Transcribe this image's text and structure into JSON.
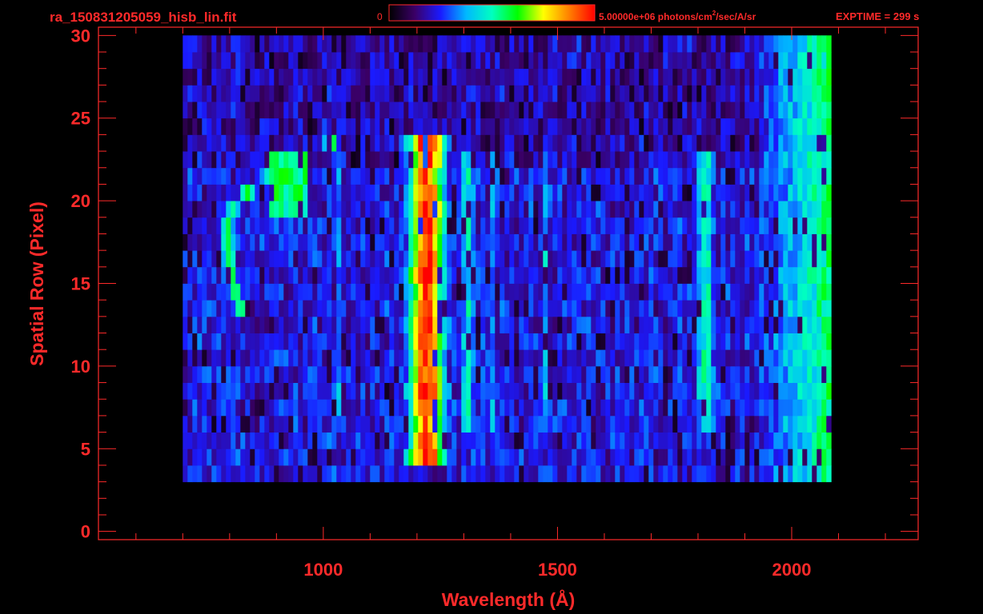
{
  "header": {
    "filename": "ra_150831205059_hisb_lin.fit",
    "colorbar_min_label": "0",
    "colorbar_max_label": "5.00000e+06 photons/cm",
    "colorbar_units_sup": "2",
    "colorbar_units_tail": "/sec/A/sr",
    "exptime_label": "EXPTIME = 299 s"
  },
  "colors": {
    "accent": "#ff2a2a",
    "background": "#000000",
    "colormap": [
      "#000000",
      "#3a0066",
      "#1a1aff",
      "#00b8ff",
      "#00ffc0",
      "#00ff00",
      "#ffff00",
      "#ff8000",
      "#ff0000"
    ]
  },
  "chart_data": {
    "type": "heatmap",
    "title": "",
    "xlabel": "Wavelength (Å)",
    "ylabel": "Spatial Row (Pixel)",
    "xlim": [
      520,
      2270
    ],
    "ylim": [
      -0.5,
      30.5
    ],
    "x_ticks": [
      1000,
      1500,
      2000
    ],
    "y_ticks": [
      0,
      5,
      10,
      15,
      20,
      25,
      30
    ],
    "data_extent": {
      "x": [
        700,
        2080
      ],
      "y": [
        3,
        30
      ]
    },
    "colorbar_range": [
      0,
      5000000
    ],
    "colorbar_unit": "photons/cm^2/sec/A/sr",
    "features": [
      {
        "name": "Lyman-alpha band",
        "x_center": 1216,
        "x_width": 50,
        "y_range": [
          4.5,
          24
        ],
        "peak_level": 0.95
      },
      {
        "name": "arc feature",
        "x_range": [
          780,
          940
        ],
        "y_range": [
          13,
          23.5
        ],
        "peak_level": 0.6
      },
      {
        "name": "emission band",
        "x_center": 1304,
        "x_width": 24,
        "y_range": [
          6,
          23
        ],
        "peak_level": 0.45
      },
      {
        "name": "emission band",
        "x_center": 1356,
        "x_width": 14,
        "y_range": [
          6,
          23
        ],
        "peak_level": 0.35
      },
      {
        "name": "emission band",
        "x_center": 1468,
        "x_width": 14,
        "y_range": [
          6,
          23
        ],
        "peak_level": 0.4
      },
      {
        "name": "emission band",
        "x_center": 1030,
        "x_width": 14,
        "y_range": [
          7,
          23
        ],
        "peak_level": 0.35
      },
      {
        "name": "emission band",
        "x_center": 1810,
        "x_width": 28,
        "y_range": [
          6,
          23
        ],
        "peak_level": 0.5
      },
      {
        "name": "long-wavelength edge",
        "x_range": [
          1930,
          2075
        ],
        "y_range": [
          1.5,
          30
        ],
        "peak_level": 0.55
      }
    ]
  }
}
